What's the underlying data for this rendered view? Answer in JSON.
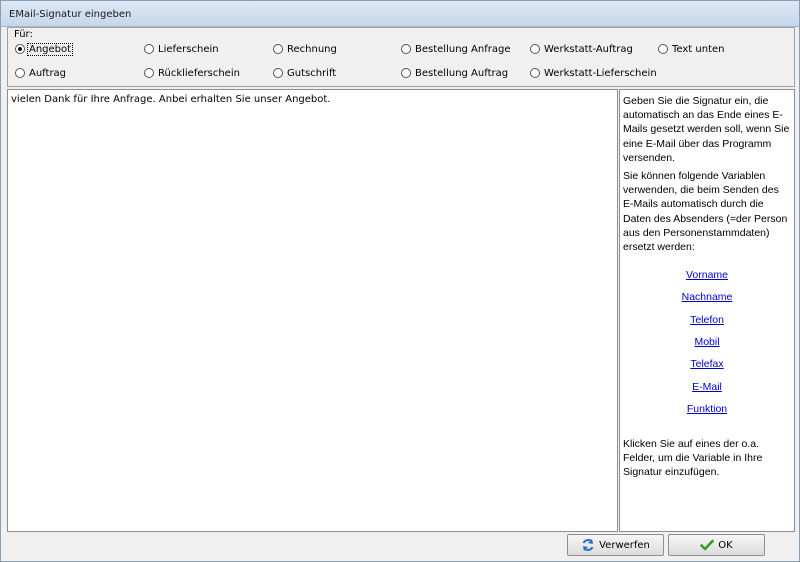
{
  "window": {
    "title": "EMail-Signatur eingeben"
  },
  "recipient_group": {
    "label": "Für:",
    "options": [
      {
        "label": "Angebot",
        "checked": true
      },
      {
        "label": "Lieferschein",
        "checked": false
      },
      {
        "label": "Rechnung",
        "checked": false
      },
      {
        "label": "Bestellung Anfrage",
        "checked": false
      },
      {
        "label": "Werkstatt-Auftrag",
        "checked": false
      },
      {
        "label": "Text unten",
        "checked": false
      },
      {
        "label": "Auftrag",
        "checked": false
      },
      {
        "label": "Rücklieferschein",
        "checked": false
      },
      {
        "label": "Gutschrift",
        "checked": false
      },
      {
        "label": "Bestellung Auftrag",
        "checked": false
      },
      {
        "label": "Werkstatt-Lieferschein",
        "checked": false
      }
    ]
  },
  "editor": {
    "text": "vielen Dank für Ihre Anfrage. Anbei erhalten Sie unser Angebot."
  },
  "help": {
    "intro": "Geben Sie die Signatur ein, die automatisch an das Ende eines E-Mails gesetzt werden soll, wenn Sie eine E-Mail über das Programm versenden.",
    "variables_intro": "Sie können folgende Variablen verwenden, die beim Senden des E-Mails automatisch durch die Daten des Absenders (=der Person aus den Personenstammdaten) ersetzt werden:",
    "variables": [
      "Vorname",
      "Nachname",
      "Telefon",
      "Mobil",
      "Telefax",
      "E-Mail",
      "Funktion"
    ],
    "outro": "Klicken Sie auf eines der o.a. Felder, um die Variable in Ihre Signatur einzufügen."
  },
  "buttons": {
    "discard": "Verwerfen",
    "ok": "OK"
  },
  "colors": {
    "link": "#0000cc",
    "ok_check": "#3a9a1e",
    "discard_icon": "#2a6fc9"
  }
}
